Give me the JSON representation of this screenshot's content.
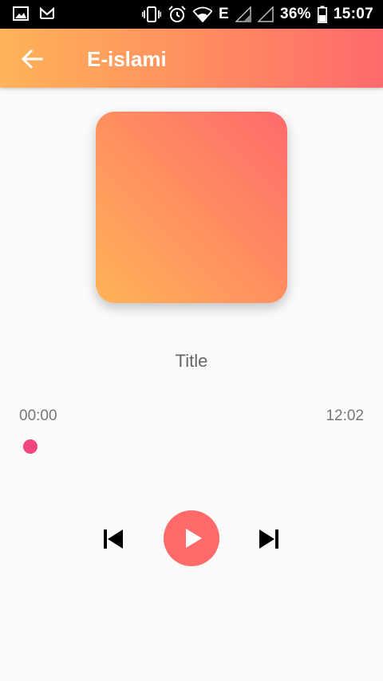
{
  "status_bar": {
    "left_icons": [
      "image-icon",
      "gmail-icon"
    ],
    "right_icons": [
      "vibrate-icon",
      "alarm-icon",
      "wifi-icon"
    ],
    "network_type": "E",
    "battery_percent": "36%",
    "time": "15:07",
    "colors": {
      "background": "#000000",
      "foreground": "#ffffff"
    }
  },
  "app_bar": {
    "back_icon": "arrow-left-icon",
    "title": "E-islami",
    "gradient": [
      "#ffb358",
      "#ff8f60",
      "#ff6a6c"
    ]
  },
  "player": {
    "track_title": "Title",
    "time_current": "00:00",
    "time_total": "12:02",
    "progress": 0,
    "thumb_color": "#f0457f",
    "controls": {
      "previous_icon": "skip-previous-icon",
      "play_icon": "play-icon",
      "next_icon": "skip-next-icon",
      "play_button_color": "#ff6b6b"
    }
  }
}
